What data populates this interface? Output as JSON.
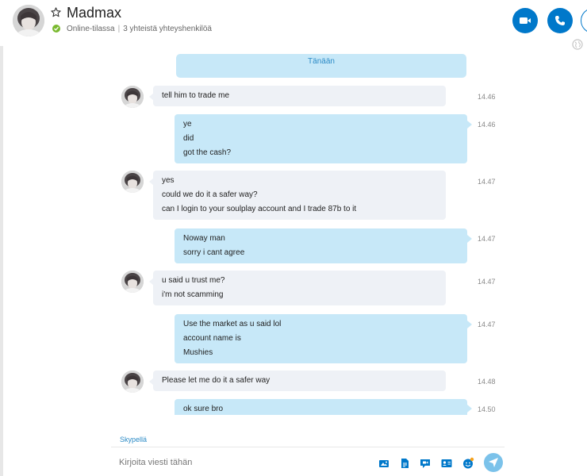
{
  "header": {
    "contact_name": "Madmax",
    "status_text": "Online-tilassa",
    "mutual_contacts": "3 yhteistä yhteyshenkilöä"
  },
  "conversation": {
    "date_label": "Tänään",
    "messages": [
      {
        "sender": "incoming",
        "lines": [
          "tell him to trade me"
        ],
        "time": "14.46"
      },
      {
        "sender": "outgoing",
        "lines": [
          "ye",
          "did",
          "got the cash?"
        ],
        "time": "14.46"
      },
      {
        "sender": "incoming",
        "lines": [
          "yes",
          "could we do it a safer way?",
          "can I login to your soulplay account and I trade 87b to it"
        ],
        "time": "14.47"
      },
      {
        "sender": "outgoing",
        "lines": [
          "Noway man",
          "sorry i cant agree"
        ],
        "time": "14.47"
      },
      {
        "sender": "incoming",
        "lines": [
          "u said u trust me?",
          "i'm not scamming"
        ],
        "time": "14.47"
      },
      {
        "sender": "outgoing",
        "lines": [
          "Use the market as u said lol",
          "account name is",
          "Mushies"
        ],
        "time": "14.47"
      },
      {
        "sender": "incoming",
        "lines": [
          "Please let me do it a safer way"
        ],
        "time": "14.48"
      },
      {
        "sender": "outgoing",
        "lines": [
          "ok sure bro"
        ],
        "time": "14.50"
      }
    ]
  },
  "composer": {
    "via_label": "Skypellä",
    "placeholder": "Kirjoita viesti tähän"
  },
  "colors": {
    "accent": "#0078ca",
    "online": "#7ab92f",
    "outgoing_bubble": "#c7e8f8",
    "incoming_bubble": "#eef1f6",
    "send_button": "#7bc2ea"
  }
}
